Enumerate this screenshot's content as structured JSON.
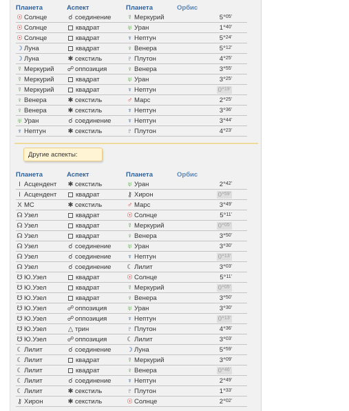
{
  "headers": {
    "planet": "Планета",
    "aspect": "Аспект",
    "planet2": "Планета",
    "orbis": "Орбис"
  },
  "other_aspects_label": "Другие аспекты:",
  "table1": [
    {
      "p1": "Солнце",
      "p1_icon": "sun-icon",
      "p1_sym": "☉",
      "p1_color": "red",
      "asp": "соединение",
      "asp_icon": "conjunction-icon",
      "asp_sym": "☌",
      "p2": "Меркурий",
      "p2_icon": "mercury-icon",
      "p2_sym": "☿",
      "p2_color": "green",
      "orb_deg": "5°",
      "orb_min": "05'",
      "hl": false
    },
    {
      "p1": "Солнце",
      "p1_icon": "sun-icon",
      "p1_sym": "☉",
      "p1_color": "red",
      "asp": "квадрат",
      "asp_icon": "square-icon",
      "asp_sym": "□",
      "p2": "Уран",
      "p2_icon": "uranus-icon",
      "p2_sym": "♅",
      "p2_color": "green",
      "orb_deg": "1°",
      "orb_min": "40'",
      "hl": false
    },
    {
      "p1": "Солнце",
      "p1_icon": "sun-icon",
      "p1_sym": "☉",
      "p1_color": "red",
      "asp": "квадрат",
      "asp_icon": "square-icon",
      "asp_sym": "□",
      "p2": "Нептун",
      "p2_icon": "neptune-icon",
      "p2_sym": "♆",
      "p2_color": "blue",
      "orb_deg": "5°",
      "orb_min": "24'",
      "hl": false
    },
    {
      "p1": "Луна",
      "p1_icon": "moon-icon",
      "p1_sym": "☽",
      "p1_color": "blue",
      "asp": "квадрат",
      "asp_icon": "square-icon",
      "asp_sym": "□",
      "p2": "Венера",
      "p2_icon": "venus-icon",
      "p2_sym": "♀",
      "p2_color": "green",
      "orb_deg": "5°",
      "orb_min": "12'",
      "hl": false
    },
    {
      "p1": "Луна",
      "p1_icon": "moon-icon",
      "p1_sym": "☽",
      "p1_color": "blue",
      "asp": "секстиль",
      "asp_icon": "sextile-icon",
      "asp_sym": "✱",
      "p2": "Плутон",
      "p2_icon": "pluto-icon",
      "p2_sym": "♇",
      "p2_color": "blue",
      "orb_deg": "4°",
      "orb_min": "25'",
      "hl": false
    },
    {
      "p1": "Меркурий",
      "p1_icon": "mercury-icon",
      "p1_sym": "☿",
      "p1_color": "green",
      "asp": "оппозиция",
      "asp_icon": "opposition-icon",
      "asp_sym": "☍",
      "p2": "Венера",
      "p2_icon": "venus-icon",
      "p2_sym": "♀",
      "p2_color": "green",
      "orb_deg": "3°",
      "orb_min": "55'",
      "hl": false
    },
    {
      "p1": "Меркурий",
      "p1_icon": "mercury-icon",
      "p1_sym": "☿",
      "p1_color": "green",
      "asp": "квадрат",
      "asp_icon": "square-icon",
      "asp_sym": "□",
      "p2": "Уран",
      "p2_icon": "uranus-icon",
      "p2_sym": "♅",
      "p2_color": "green",
      "orb_deg": "3°",
      "orb_min": "25'",
      "hl": false
    },
    {
      "p1": "Меркурий",
      "p1_icon": "mercury-icon",
      "p1_sym": "☿",
      "p1_color": "green",
      "asp": "квадрат",
      "asp_icon": "square-icon",
      "asp_sym": "□",
      "p2": "Нептун",
      "p2_icon": "neptune-icon",
      "p2_sym": "♆",
      "p2_color": "blue",
      "orb_deg": "0°",
      "orb_min": "19'",
      "hl": true
    },
    {
      "p1": "Венера",
      "p1_icon": "venus-icon",
      "p1_sym": "♀",
      "p1_color": "green",
      "asp": "секстиль",
      "asp_icon": "sextile-icon",
      "asp_sym": "✱",
      "p2": "Марс",
      "p2_icon": "mars-icon",
      "p2_sym": "♂",
      "p2_color": "red",
      "orb_deg": "2°",
      "orb_min": "25'",
      "hl": false
    },
    {
      "p1": "Венера",
      "p1_icon": "venus-icon",
      "p1_sym": "♀",
      "p1_color": "green",
      "asp": "секстиль",
      "asp_icon": "sextile-icon",
      "asp_sym": "✱",
      "p2": "Нептун",
      "p2_icon": "neptune-icon",
      "p2_sym": "♆",
      "p2_color": "blue",
      "orb_deg": "3°",
      "orb_min": "36'",
      "hl": false
    },
    {
      "p1": "Уран",
      "p1_icon": "uranus-icon",
      "p1_sym": "♅",
      "p1_color": "green",
      "asp": "соединение",
      "asp_icon": "conjunction-icon",
      "asp_sym": "☌",
      "p2": "Нептун",
      "p2_icon": "neptune-icon",
      "p2_sym": "♆",
      "p2_color": "blue",
      "orb_deg": "3°",
      "orb_min": "44'",
      "hl": false
    },
    {
      "p1": "Нептун",
      "p1_icon": "neptune-icon",
      "p1_sym": "♆",
      "p1_color": "blue",
      "asp": "секстиль",
      "asp_icon": "sextile-icon",
      "asp_sym": "✱",
      "p2": "Плутон",
      "p2_icon": "pluto-icon",
      "p2_sym": "♇",
      "p2_color": "blue",
      "orb_deg": "4°",
      "orb_min": "23'",
      "hl": false
    }
  ],
  "table2": [
    {
      "p1": "Асцендент",
      "p1_icon": "ascendant-icon",
      "p1_sym": "I",
      "p1_color": "gray",
      "asp": "секстиль",
      "asp_icon": "sextile-icon",
      "asp_sym": "✱",
      "p2": "Уран",
      "p2_icon": "uranus-icon",
      "p2_sym": "♅",
      "p2_color": "green",
      "orb_deg": "2°",
      "orb_min": "42'",
      "hl": false
    },
    {
      "p1": "Асцендент",
      "p1_icon": "ascendant-icon",
      "p1_sym": "I",
      "p1_color": "gray",
      "asp": "квадрат",
      "asp_icon": "square-icon",
      "asp_sym": "□",
      "p2": "Хирон",
      "p2_icon": "chiron-icon",
      "p2_sym": "⚷",
      "p2_color": "gray",
      "orb_deg": "0°",
      "orb_min": "59'",
      "hl": true
    },
    {
      "p1": "MC",
      "p1_icon": "mc-icon",
      "p1_sym": "X",
      "p1_color": "gray",
      "asp": "секстиль",
      "asp_icon": "sextile-icon",
      "asp_sym": "✱",
      "p2": "Марс",
      "p2_icon": "mars-icon",
      "p2_sym": "♂",
      "p2_color": "red",
      "orb_deg": "3°",
      "orb_min": "49'",
      "hl": false
    },
    {
      "p1": "Узел",
      "p1_icon": "north-node-icon",
      "p1_sym": "☊",
      "p1_color": "gray",
      "asp": "квадрат",
      "asp_icon": "square-icon",
      "asp_sym": "□",
      "p2": "Солнце",
      "p2_icon": "sun-icon",
      "p2_sym": "☉",
      "p2_color": "red",
      "orb_deg": "5°",
      "orb_min": "11'",
      "hl": false
    },
    {
      "p1": "Узел",
      "p1_icon": "north-node-icon",
      "p1_sym": "☊",
      "p1_color": "gray",
      "asp": "квадрат",
      "asp_icon": "square-icon",
      "asp_sym": "□",
      "p2": "Меркурий",
      "p2_icon": "mercury-icon",
      "p2_sym": "☿",
      "p2_color": "green",
      "orb_deg": "0°",
      "orb_min": "05'",
      "hl": true
    },
    {
      "p1": "Узел",
      "p1_icon": "north-node-icon",
      "p1_sym": "☊",
      "p1_color": "gray",
      "asp": "квадрат",
      "asp_icon": "square-icon",
      "asp_sym": "□",
      "p2": "Венера",
      "p2_icon": "venus-icon",
      "p2_sym": "♀",
      "p2_color": "green",
      "orb_deg": "3°",
      "orb_min": "50'",
      "hl": false
    },
    {
      "p1": "Узел",
      "p1_icon": "north-node-icon",
      "p1_sym": "☊",
      "p1_color": "gray",
      "asp": "соединение",
      "asp_icon": "conjunction-icon",
      "asp_sym": "☌",
      "p2": "Уран",
      "p2_icon": "uranus-icon",
      "p2_sym": "♅",
      "p2_color": "green",
      "orb_deg": "3°",
      "orb_min": "30'",
      "hl": false
    },
    {
      "p1": "Узел",
      "p1_icon": "north-node-icon",
      "p1_sym": "☊",
      "p1_color": "gray",
      "asp": "соединение",
      "asp_icon": "conjunction-icon",
      "asp_sym": "☌",
      "p2": "Нептун",
      "p2_icon": "neptune-icon",
      "p2_sym": "♆",
      "p2_color": "blue",
      "orb_deg": "0°",
      "orb_min": "13'",
      "hl": true
    },
    {
      "p1": "Узел",
      "p1_icon": "north-node-icon",
      "p1_sym": "☊",
      "p1_color": "gray",
      "asp": "соединение",
      "asp_icon": "conjunction-icon",
      "asp_sym": "☌",
      "p2": "Лилит",
      "p2_icon": "lilith-icon",
      "p2_sym": "☾",
      "p2_color": "gray",
      "orb_deg": "3°",
      "orb_min": "03'",
      "hl": false
    },
    {
      "p1": "Ю.Узел",
      "p1_icon": "south-node-icon",
      "p1_sym": "☋",
      "p1_color": "gray",
      "asp": "квадрат",
      "asp_icon": "square-icon",
      "asp_sym": "□",
      "p2": "Солнце",
      "p2_icon": "sun-icon",
      "p2_sym": "☉",
      "p2_color": "red",
      "orb_deg": "5°",
      "orb_min": "11'",
      "hl": false
    },
    {
      "p1": "Ю.Узел",
      "p1_icon": "south-node-icon",
      "p1_sym": "☋",
      "p1_color": "gray",
      "asp": "квадрат",
      "asp_icon": "square-icon",
      "asp_sym": "□",
      "p2": "Меркурий",
      "p2_icon": "mercury-icon",
      "p2_sym": "☿",
      "p2_color": "green",
      "orb_deg": "0°",
      "orb_min": "05'",
      "hl": true
    },
    {
      "p1": "Ю.Узел",
      "p1_icon": "south-node-icon",
      "p1_sym": "☋",
      "p1_color": "gray",
      "asp": "квадрат",
      "asp_icon": "square-icon",
      "asp_sym": "□",
      "p2": "Венера",
      "p2_icon": "venus-icon",
      "p2_sym": "♀",
      "p2_color": "green",
      "orb_deg": "3°",
      "orb_min": "50'",
      "hl": false
    },
    {
      "p1": "Ю.Узел",
      "p1_icon": "south-node-icon",
      "p1_sym": "☋",
      "p1_color": "gray",
      "asp": "оппозиция",
      "asp_icon": "opposition-icon",
      "asp_sym": "☍",
      "p2": "Уран",
      "p2_icon": "uranus-icon",
      "p2_sym": "♅",
      "p2_color": "green",
      "orb_deg": "3°",
      "orb_min": "30'",
      "hl": false
    },
    {
      "p1": "Ю.Узел",
      "p1_icon": "south-node-icon",
      "p1_sym": "☋",
      "p1_color": "gray",
      "asp": "оппозиция",
      "asp_icon": "opposition-icon",
      "asp_sym": "☍",
      "p2": "Нептун",
      "p2_icon": "neptune-icon",
      "p2_sym": "♆",
      "p2_color": "blue",
      "orb_deg": "0°",
      "orb_min": "13'",
      "hl": true
    },
    {
      "p1": "Ю.Узел",
      "p1_icon": "south-node-icon",
      "p1_sym": "☋",
      "p1_color": "gray",
      "asp": "трин",
      "asp_icon": "trine-icon",
      "asp_sym": "△",
      "p2": "Плутон",
      "p2_icon": "pluto-icon",
      "p2_sym": "♇",
      "p2_color": "blue",
      "orb_deg": "4°",
      "orb_min": "36'",
      "hl": false
    },
    {
      "p1": "Ю.Узел",
      "p1_icon": "south-node-icon",
      "p1_sym": "☋",
      "p1_color": "gray",
      "asp": "оппозиция",
      "asp_icon": "opposition-icon",
      "asp_sym": "☍",
      "p2": "Лилит",
      "p2_icon": "lilith-icon",
      "p2_sym": "☾",
      "p2_color": "gray",
      "orb_deg": "3°",
      "orb_min": "03'",
      "hl": false
    },
    {
      "p1": "Лилит",
      "p1_icon": "lilith-icon",
      "p1_sym": "☾",
      "p1_color": "gray",
      "asp": "соединение",
      "asp_icon": "conjunction-icon",
      "asp_sym": "☌",
      "p2": "Луна",
      "p2_icon": "moon-icon",
      "p2_sym": "☽",
      "p2_color": "blue",
      "orb_deg": "5°",
      "orb_min": "59'",
      "hl": false
    },
    {
      "p1": "Лилит",
      "p1_icon": "lilith-icon",
      "p1_sym": "☾",
      "p1_color": "gray",
      "asp": "квадрат",
      "asp_icon": "square-icon",
      "asp_sym": "□",
      "p2": "Меркурий",
      "p2_icon": "mercury-icon",
      "p2_sym": "☿",
      "p2_color": "green",
      "orb_deg": "3°",
      "orb_min": "09'",
      "hl": false
    },
    {
      "p1": "Лилит",
      "p1_icon": "lilith-icon",
      "p1_sym": "☾",
      "p1_color": "gray",
      "asp": "квадрат",
      "asp_icon": "square-icon",
      "asp_sym": "□",
      "p2": "Венера",
      "p2_icon": "venus-icon",
      "p2_sym": "♀",
      "p2_color": "green",
      "orb_deg": "0°",
      "orb_min": "46'",
      "hl": true
    },
    {
      "p1": "Лилит",
      "p1_icon": "lilith-icon",
      "p1_sym": "☾",
      "p1_color": "gray",
      "asp": "соединение",
      "asp_icon": "conjunction-icon",
      "asp_sym": "☌",
      "p2": "Нептун",
      "p2_icon": "neptune-icon",
      "p2_sym": "♆",
      "p2_color": "blue",
      "orb_deg": "2°",
      "orb_min": "49'",
      "hl": false
    },
    {
      "p1": "Лилит",
      "p1_icon": "lilith-icon",
      "p1_sym": "☾",
      "p1_color": "gray",
      "asp": "секстиль",
      "asp_icon": "sextile-icon",
      "asp_sym": "✱",
      "p2": "Плутон",
      "p2_icon": "pluto-icon",
      "p2_sym": "♇",
      "p2_color": "blue",
      "orb_deg": "1°",
      "orb_min": "33'",
      "hl": false
    },
    {
      "p1": "Хирон",
      "p1_icon": "chiron-icon",
      "p1_sym": "⚷",
      "p1_color": "gray",
      "asp": "секстиль",
      "asp_icon": "sextile-icon",
      "asp_sym": "✱",
      "p2": "Солнце",
      "p2_icon": "sun-icon",
      "p2_sym": "☉",
      "p2_color": "red",
      "orb_deg": "2°",
      "orb_min": "02'",
      "hl": false
    }
  ]
}
